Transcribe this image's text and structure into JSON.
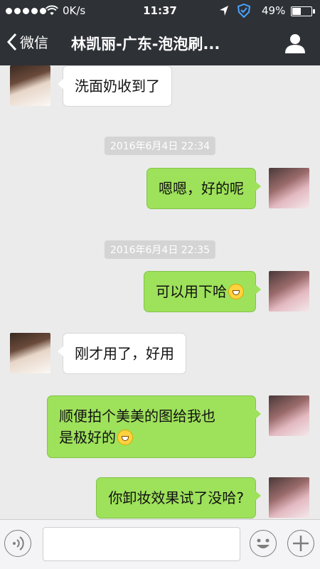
{
  "status_bar": {
    "network": "0K/s",
    "time": "11:37",
    "battery": "49%"
  },
  "nav": {
    "back_label": "微信",
    "title": "林凯丽-广东-泡泡刷..."
  },
  "messages": [
    {
      "type": "received",
      "text": "洗面奶收到了"
    },
    {
      "type": "timestamp",
      "text": "2016年6月4日 22:34"
    },
    {
      "type": "sent",
      "text": "嗯嗯，好的呢"
    },
    {
      "type": "timestamp",
      "text": "2016年6月4日 22:35"
    },
    {
      "type": "sent",
      "text": "可以用下哈",
      "emoji": "grin-emoji"
    },
    {
      "type": "received",
      "text": "刚才用了，好用"
    },
    {
      "type": "sent",
      "text_line1": "顺便拍个美美的图给我也",
      "text_line2": "是极好的",
      "emoji": "heart-eyes-emoji"
    },
    {
      "type": "sent",
      "text": "你卸妆效果试了没哈?"
    }
  ],
  "input_bar": {
    "placeholder": ""
  },
  "colors": {
    "nav_bg": "#2e3136",
    "chat_bg": "#ebebeb",
    "sent_bubble": "#9ee15b",
    "received_bubble": "#ffffff"
  }
}
